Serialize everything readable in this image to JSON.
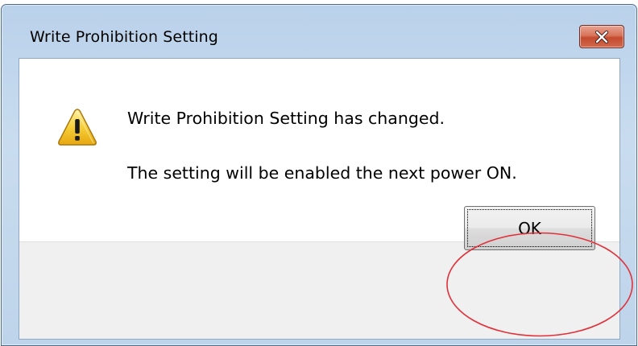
{
  "dialog": {
    "title": "Write Prohibition Setting",
    "close_icon": "close-icon",
    "warning_icon": "warning-icon",
    "message_line1": "Write Prohibition Setting has changed.",
    "message_line2": "The setting will be enabled the next power ON.",
    "ok_label": "OK"
  },
  "annotation": {
    "highlight_color": "#e0303a",
    "highlight_shape": "ellipse around OK button"
  },
  "colors": {
    "close_button": "#c44a2e",
    "frame": "#bed4ea",
    "footer": "#f0f0f0"
  }
}
